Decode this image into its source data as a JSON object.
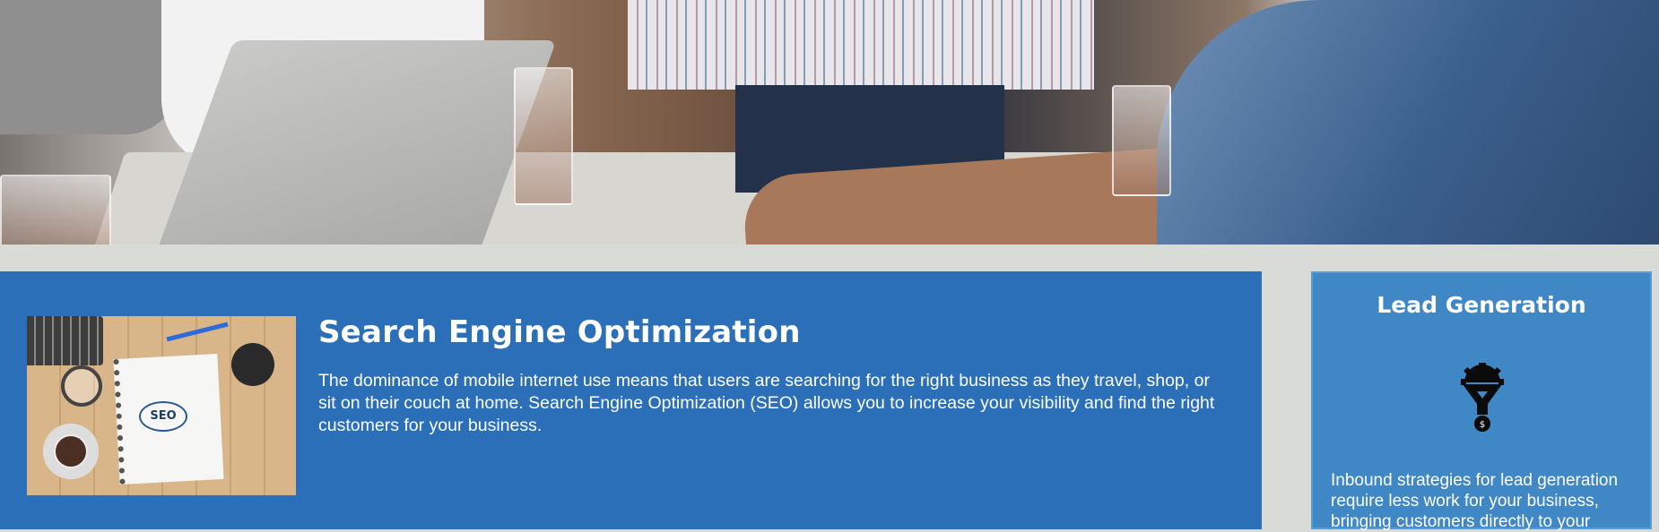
{
  "hero": {
    "image": "team-meeting-photo"
  },
  "seo_card": {
    "image_text": "SEO",
    "title": "Search Engine Optimization",
    "body": "The dominance of mobile internet use means that users are searching for the right business as they travel, shop, or sit on their couch at home. Search Engine Optimization (SEO) allows you to increase your visibility and find the right customers for your business.",
    "background": "#2c6fb9"
  },
  "lead_card": {
    "title": "Lead Generation",
    "icon": "lead-funnel-icon",
    "body": "Inbound strategies for lead generation require less work for your business, bringing customers directly to your",
    "background": "#3f88c5"
  },
  "colors": {
    "page_background": "#d9dcd6",
    "text": "#ffffff"
  }
}
